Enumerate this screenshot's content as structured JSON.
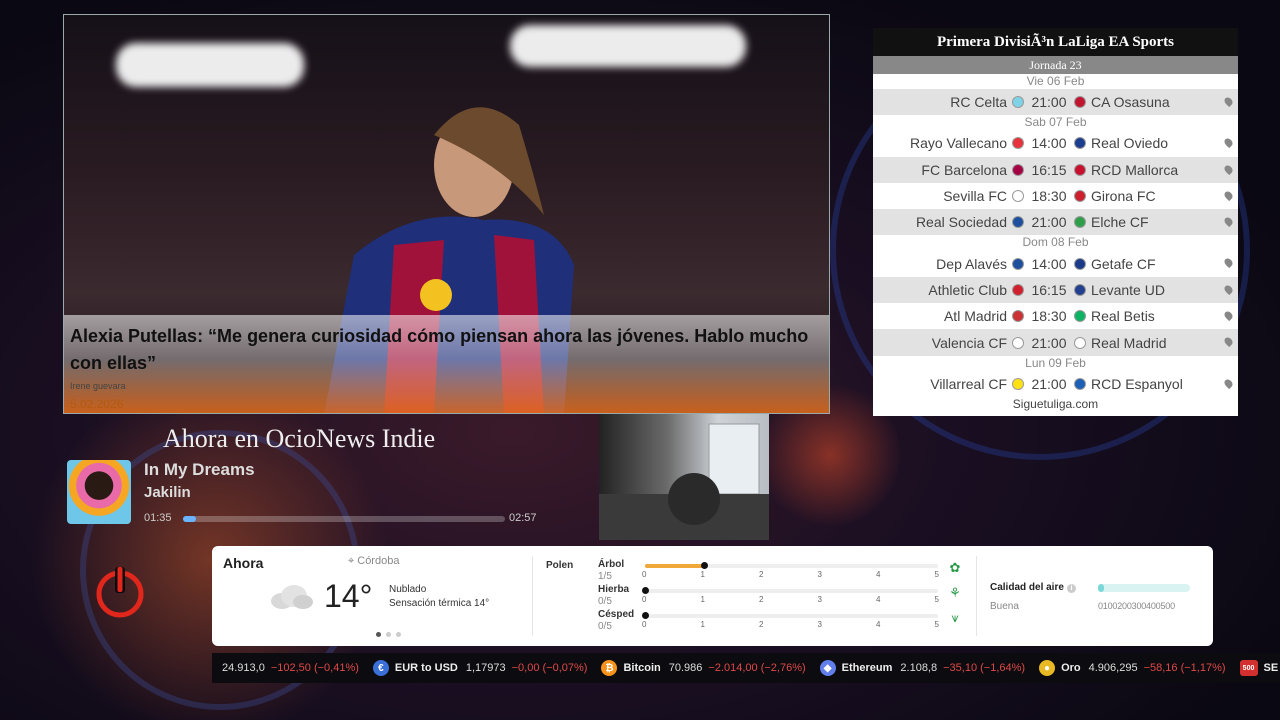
{
  "news": {
    "title": "Alexia Putellas: “Me genera curiosidad cómo piensan ahora las jóvenes. Hablo mucho con ellas”",
    "author": "Irene guevara",
    "date": "5.02.2026"
  },
  "schedule": {
    "title": "Primera DivisiÃ³n LaLiga EA Sports",
    "jornada": "Jornada 23",
    "footer": "Siguetuliga.com",
    "days": [
      {
        "date": "Vie 06 Feb",
        "matches": [
          {
            "home": "RC Celta",
            "time": "21:00",
            "away": "CA Osasuna",
            "home_color": "#7fd3e8",
            "away_color": "#c0152f"
          }
        ]
      },
      {
        "date": "Sab 07 Feb",
        "matches": [
          {
            "home": "Rayo Vallecano",
            "time": "14:00",
            "away": "Real Oviedo",
            "home_color": "#e8323c",
            "away_color": "#1d3d8f"
          },
          {
            "home": "FC Barcelona",
            "time": "16:15",
            "away": "RCD Mallorca",
            "home_color": "#a50044",
            "away_color": "#c8102e"
          },
          {
            "home": "Sevilla FC",
            "time": "18:30",
            "away": "Girona FC",
            "home_color": "#ffffff",
            "away_color": "#cd1f2d"
          },
          {
            "home": "Real Sociedad",
            "time": "21:00",
            "away": "Elche CF",
            "home_color": "#1d4f9e",
            "away_color": "#2f9e4a"
          }
        ]
      },
      {
        "date": "Dom 08 Feb",
        "matches": [
          {
            "home": "Dep Alavés",
            "time": "14:00",
            "away": "Getafe CF",
            "home_color": "#1d4f9e",
            "away_color": "#1b3a8a"
          },
          {
            "home": "Athletic Club",
            "time": "16:15",
            "away": "Levante UD",
            "home_color": "#d11f2d",
            "away_color": "#23408e"
          },
          {
            "home": "Atl Madrid",
            "time": "18:30",
            "away": "Real Betis",
            "home_color": "#cb3234",
            "away_color": "#0bb363"
          },
          {
            "home": "Valencia CF",
            "time": "21:00",
            "away": "Real Madrid",
            "home_color": "#ffffff",
            "away_color": "#ffffff"
          }
        ]
      },
      {
        "date": "Lun 09 Feb",
        "matches": [
          {
            "home": "Villarreal CF",
            "time": "21:00",
            "away": "RCD Espanyol",
            "home_color": "#ffe114",
            "away_color": "#1d5fb5"
          }
        ]
      }
    ]
  },
  "now_playing": {
    "heading": "Ahora en OcioNews Indie",
    "title": "In My Dreams",
    "artist": "Jakilin",
    "elapsed": "01:35",
    "total": "02:57",
    "progress": 0.04
  },
  "weather": {
    "now_label": "Ahora",
    "city": "Córdoba",
    "temperature": "14°",
    "condition": "Nublado",
    "feels_like": "Sensación térmica 14°",
    "pollen_label": "Polen",
    "pollen": [
      {
        "name": "Árbol",
        "value": "1/5",
        "level": 1
      },
      {
        "name": "Hierba",
        "value": "0/5",
        "level": 0
      },
      {
        "name": "Césped",
        "value": "0/5",
        "level": 0
      }
    ],
    "pollen_ticks": [
      "0",
      "1",
      "2",
      "3",
      "4",
      "5"
    ],
    "air_quality_label": "Calidad del aire",
    "air_quality_value": "Buena",
    "air_quality_scale": "0100200300400500",
    "air_quality_level": 0.05
  },
  "ticker": [
    {
      "name": "",
      "price": "24.913,0",
      "change": "−102,50 (−0,41%)",
      "icon": "index",
      "color": ""
    },
    {
      "name": "EUR to USD",
      "price": "1,17973",
      "change": "−0,00 (−0,07%)",
      "icon": "currency-icon",
      "color": "#3a6fd8"
    },
    {
      "name": "Bitcoin",
      "price": "70.986",
      "change": "−2.014,00 (−2,76%)",
      "icon": "bitcoin-icon",
      "color": "#f7931a"
    },
    {
      "name": "Ethereum",
      "price": "2.108,8",
      "change": "−35,10 (−1,64%)",
      "icon": "ethereum-icon",
      "color": "#627eea"
    },
    {
      "name": "Oro",
      "price": "4.906,295",
      "change": "−58,16 (−1,17%)",
      "icon": "gold-icon",
      "color": "#e8b923"
    },
    {
      "name": "SE",
      "price": "",
      "change": "",
      "icon": "500",
      "color": "#d32f2f"
    }
  ]
}
